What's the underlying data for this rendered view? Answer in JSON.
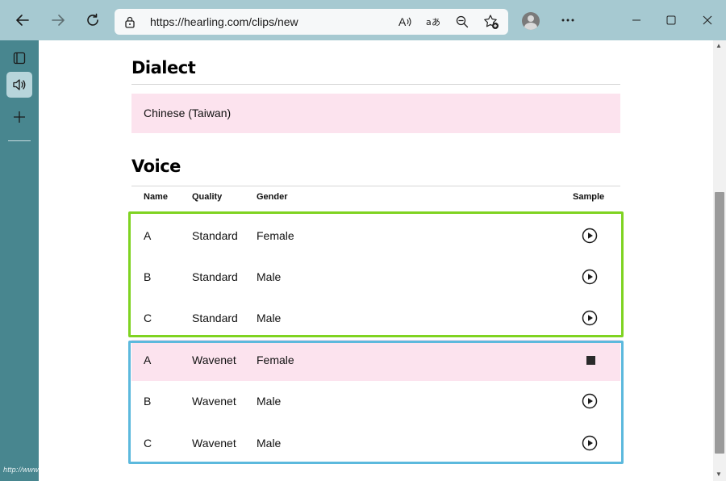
{
  "browser": {
    "url": "https://hearling.com/clips/new"
  },
  "page": {
    "dialect_heading": "Dialect",
    "dialect_value": "Chinese (Taiwan)",
    "voice_heading": "Voice",
    "table": {
      "headers": {
        "name": "Name",
        "quality": "Quality",
        "gender": "Gender",
        "sample": "Sample"
      },
      "rows": [
        {
          "name": "A",
          "quality": "Standard",
          "gender": "Female",
          "sample_state": "play-icon"
        },
        {
          "name": "B",
          "quality": "Standard",
          "gender": "Male",
          "sample_state": "play-icon"
        },
        {
          "name": "C",
          "quality": "Standard",
          "gender": "Male",
          "sample_state": "play-icon"
        },
        {
          "name": "A",
          "quality": "Wavenet",
          "gender": "Female",
          "sample_state": "stop-icon",
          "selected": true
        },
        {
          "name": "B",
          "quality": "Wavenet",
          "gender": "Male",
          "sample_state": "play-icon"
        },
        {
          "name": "C",
          "quality": "Wavenet",
          "gender": "Male",
          "sample_state": "play-icon"
        }
      ]
    }
  },
  "annotations": {
    "standard_group_color": "#7fd321",
    "wavenet_group_color": "#5cb9dd"
  },
  "colors": {
    "chrome_bg": "#a6c9d1",
    "sidebar_bg": "#48868f",
    "highlight_row": "#fce3ee"
  },
  "watermark": "http://www.xiaoyao.tw/"
}
